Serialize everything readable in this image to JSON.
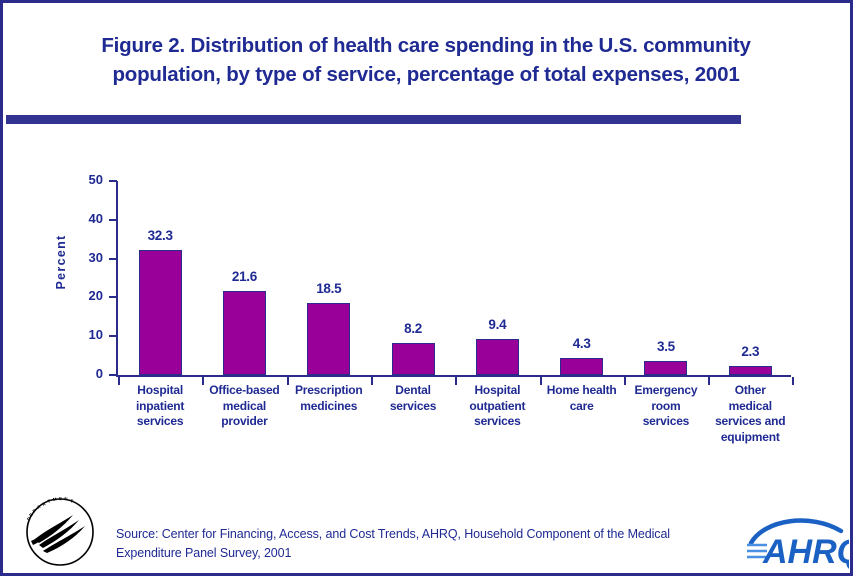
{
  "figure": {
    "title_line1": "Figure 2. Distribution of health care spending in the U.S. community",
    "title_line2": "population, by type of service, percentage of total expenses, 2001",
    "source_line1": "Source: Center for Financing, Access, and Cost Trends, AHRQ, Household Component of the Medical",
    "source_line2": "Expenditure Panel Survey, 2001"
  },
  "logos": {
    "hhs_alt": "hhs-seal-logo",
    "ahrq_alt": "ahrq-logo",
    "ahrq_text": "AHRQ"
  },
  "colors": {
    "title_blue": "#1f2a93",
    "rule_blue": "#333392",
    "border_blue": "#2b2b8c",
    "bar_magenta": "#990099",
    "bar_outline": "#2b2b8c",
    "ahrq_blue": "#1b61c4",
    "background": "#ffffff"
  },
  "chart_data": {
    "type": "bar",
    "title": "Figure 2. Distribution of health care spending in the U.S. community population, by type of service, percentage of total expenses, 2001",
    "xlabel": "",
    "ylabel": "Percent",
    "ylim": [
      0,
      50
    ],
    "yticks": [
      0,
      10,
      20,
      30,
      40,
      50
    ],
    "grid": false,
    "legend": "none",
    "categories": [
      "Hospital inpatient services",
      "Office-based medical provider",
      "Prescription medicines",
      "Dental services",
      "Hospital outpatient services",
      "Home health care",
      "Emergency room services",
      "Other medical services and equipment"
    ],
    "category_lines": [
      [
        "Hospital",
        "inpatient",
        "services"
      ],
      [
        "Office-based",
        "medical",
        "provider"
      ],
      [
        "Prescription",
        "medicines"
      ],
      [
        "Dental",
        "services"
      ],
      [
        "Hospital",
        "outpatient",
        "services"
      ],
      [
        "Home health",
        "care"
      ],
      [
        "Emergency",
        "room",
        "services"
      ],
      [
        "Other",
        "medical",
        "services and",
        "equipment"
      ]
    ],
    "values": [
      32.3,
      21.6,
      18.5,
      8.2,
      9.4,
      4.3,
      3.5,
      2.3
    ],
    "value_labels": [
      "32.3",
      "21.6",
      "18.5",
      "8.2",
      "9.4",
      "4.3",
      "3.5",
      "2.3"
    ]
  }
}
